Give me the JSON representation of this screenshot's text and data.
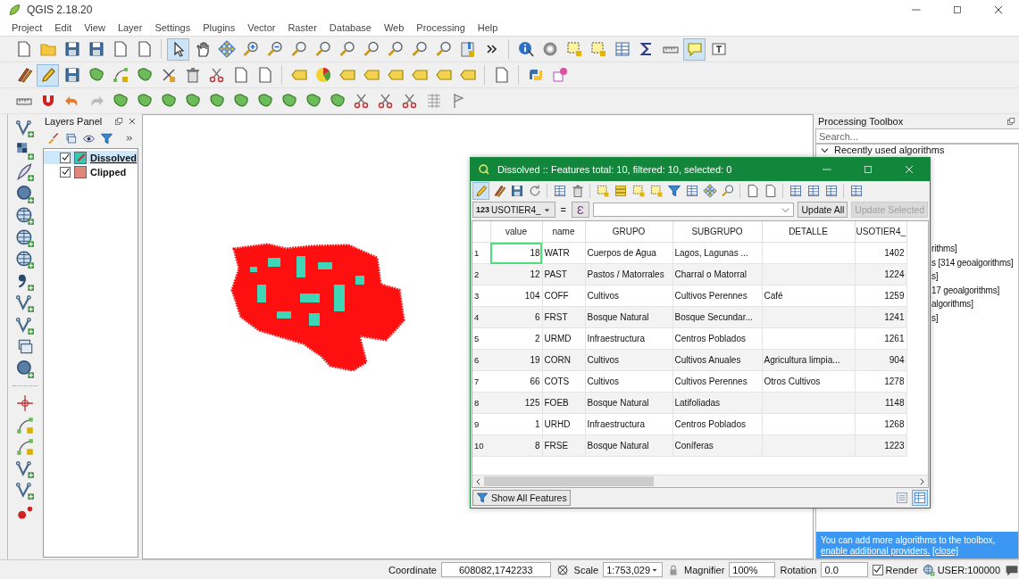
{
  "window": {
    "title": "QGIS 2.18.20"
  },
  "menu": [
    "Project",
    "Edit",
    "View",
    "Layer",
    "Settings",
    "Plugins",
    "Vector",
    "Raster",
    "Database",
    "Web",
    "Processing",
    "Help"
  ],
  "toolbars": [
    {
      "buttons": [
        {
          "active": false
        },
        {
          "active": false
        },
        {
          "active": false
        },
        {
          "active": false
        },
        {
          "active": false
        },
        {
          "active": false
        },
        {
          "active": true
        },
        {
          "active": false
        },
        {
          "active": false
        },
        {
          "active": false
        },
        {
          "active": false
        },
        {
          "active": false
        },
        {
          "active": false
        },
        {
          "active": false
        },
        {
          "active": false
        },
        {
          "active": false
        },
        {
          "active": false
        },
        {
          "active": false
        },
        {
          "active": false
        },
        {
          "active": false
        },
        {
          "active": false
        },
        {
          "active": false
        },
        {
          "active": false
        },
        {
          "active": false
        },
        {
          "active": false
        },
        {
          "active": false
        },
        {
          "active": false
        },
        {
          "active": true
        },
        {
          "active": false
        }
      ]
    },
    {
      "buttons": [
        {
          "active": false
        },
        {
          "active": true
        },
        {
          "active": false
        },
        {
          "active": false
        },
        {
          "active": false
        },
        {
          "active": false
        },
        {
          "active": false
        },
        {
          "active": false
        },
        {
          "active": false
        },
        {
          "active": false
        },
        {
          "active": false
        },
        {
          "active": false
        },
        {
          "active": false
        },
        {
          "active": false
        },
        {
          "active": false
        },
        {
          "active": false
        },
        {
          "active": false
        },
        {
          "active": false
        },
        {
          "active": false
        },
        {
          "active": false
        },
        {
          "active": false
        },
        {
          "active": false
        }
      ]
    },
    {
      "buttons": [
        {
          "active": false
        },
        {
          "active": false
        },
        {
          "active": false
        },
        {
          "active": false
        },
        {
          "active": false
        },
        {
          "active": false
        },
        {
          "active": false
        },
        {
          "active": false
        },
        {
          "active": false
        },
        {
          "active": false
        },
        {
          "active": false
        },
        {
          "active": false
        },
        {
          "active": false
        },
        {
          "active": false
        },
        {
          "active": false
        },
        {
          "active": false
        },
        {
          "active": false
        },
        {
          "active": false
        },
        {
          "active": false
        }
      ]
    }
  ],
  "layers_panel": {
    "title": "Layers Panel",
    "layers": [
      {
        "name": "Dissolved",
        "checked": true,
        "selected": true,
        "editing": true,
        "color": "#35c9b4"
      },
      {
        "name": "Clipped",
        "checked": true,
        "selected": false,
        "editing": false,
        "color": "#e0877a"
      }
    ]
  },
  "processing_toolbox": {
    "title": "Processing Toolbox",
    "search_placeholder": "Search...",
    "groups": [
      {
        "label": "Recently used algorithms",
        "expanded": true
      }
    ],
    "partly_hidden_entries": [
      "rithms]",
      "s [314 geoalgorithms]",
      "s]",
      "17 geoalgorithms]",
      "algorithms]",
      "s]"
    ],
    "notice": {
      "text": "You can add more algorithms to the toolbox, ",
      "link": "enable additional providers.",
      "close_link": "[close]"
    }
  },
  "attribute_table": {
    "title": "Dissolved :: Features total: 10, filtered: 10, selected: 0",
    "toolbar": [
      {
        "active": true
      },
      {
        "active": false
      },
      {
        "active": false
      },
      {
        "active": false
      },
      {
        "active": false
      },
      {
        "active": false
      },
      {
        "active": false
      },
      {
        "active": false
      },
      {
        "active": false
      },
      {
        "active": false
      },
      {
        "active": false
      },
      {
        "active": false
      },
      {
        "active": false
      },
      {
        "active": false
      },
      {
        "active": false
      },
      {
        "active": false
      },
      {
        "active": false
      },
      {
        "active": false
      },
      {
        "active": false
      },
      {
        "active": false
      }
    ],
    "field_type": "123",
    "field": "USOTIER4_",
    "operator": "=",
    "expression_button": "Ɛ",
    "update_all": {
      "label": "Update All",
      "disabled": false
    },
    "update_selected": {
      "label": "Update Selected",
      "disabled": true
    },
    "columns": [
      "value",
      "name",
      "GRUPO",
      "SUBGRUPO",
      "DETALLE",
      "USOTIER4_"
    ],
    "rows": [
      {
        "number": "1",
        "cells": [
          "18",
          "WATR",
          "Cuerpos de Agua",
          "Lagos, Lagunas ...",
          "",
          "1402"
        ],
        "focused": true
      },
      {
        "number": "2",
        "cells": [
          "12",
          "PAST",
          "Pastos / Matorrales",
          "Charral o Matorral",
          "",
          "1224"
        ],
        "focused": false
      },
      {
        "number": "3",
        "cells": [
          "104",
          "COFF",
          "Cultivos",
          "Cultivos Perennes",
          "Café",
          "1259"
        ],
        "focused": false
      },
      {
        "number": "4",
        "cells": [
          "6",
          "FRST",
          "Bosque Natural",
          "Bosque Secundar...",
          "",
          "1241"
        ],
        "focused": false
      },
      {
        "number": "5",
        "cells": [
          "2",
          "URMD",
          "Infraestructura",
          "Centros Poblados",
          "",
          "1261"
        ],
        "focused": false
      },
      {
        "number": "6",
        "cells": [
          "19",
          "CORN",
          "Cultivos",
          "Cultivos Anuales",
          "Agricultura limpia...",
          "904"
        ],
        "focused": false
      },
      {
        "number": "7",
        "cells": [
          "66",
          "COTS",
          "Cultivos",
          "Cultivos Perennes",
          "Otros Cultivos",
          "1278"
        ],
        "focused": false
      },
      {
        "number": "8",
        "cells": [
          "125",
          "FOEB",
          "Bosque Natural",
          "Latifoliadas",
          "",
          "1148"
        ],
        "focused": false
      },
      {
        "number": "9",
        "cells": [
          "1",
          "URHD",
          "Infraestructura",
          "Centros Poblados",
          "",
          "1268"
        ],
        "focused": false
      },
      {
        "number": "10",
        "cells": [
          "8",
          "FRSE",
          "Bosque Natural",
          "Coníferas",
          "",
          "1223"
        ],
        "focused": false
      }
    ],
    "show_all": "Show All Features",
    "views": [
      {
        "selected": false
      },
      {
        "selected": true
      }
    ]
  },
  "status_bar": {
    "coordinate_label": "Coordinate",
    "coordinate": "608082,1742233",
    "scale_label": "Scale",
    "scale": "1:753,029",
    "magnifier_label": "Magnifier",
    "magnifier": "100%",
    "rotation_label": "Rotation",
    "rotation": "0.0",
    "render": {
      "label": "Render",
      "checked": true
    },
    "crs": "USER:100000"
  }
}
